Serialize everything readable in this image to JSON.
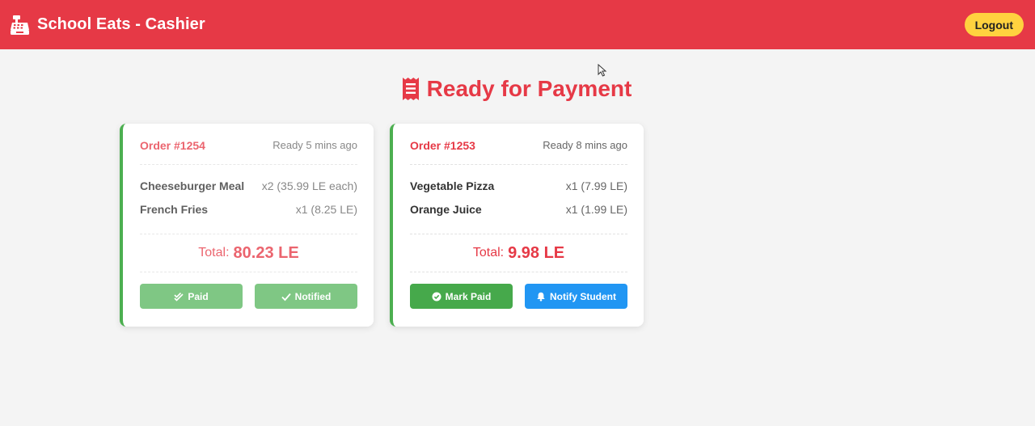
{
  "header": {
    "title": "School Eats - Cashier",
    "logout_label": "Logout",
    "icon": "cash-register-icon"
  },
  "page": {
    "heading": "Ready for Payment",
    "heading_icon": "receipt-icon"
  },
  "orders": [
    {
      "number": "Order #1254",
      "ready": "Ready 5 mins ago",
      "items": [
        {
          "name": "Cheeseburger Meal",
          "qty": "x2 (35.99 LE each)"
        },
        {
          "name": "French Fries",
          "qty": "x1 (8.25 LE)"
        }
      ],
      "total_label": "Total:",
      "total_value": "80.23 LE",
      "status": "completed",
      "actions": {
        "pay_label": "Paid",
        "notify_label": "Notified"
      }
    },
    {
      "number": "Order #1253",
      "ready": "Ready 8 mins ago",
      "items": [
        {
          "name": "Vegetable Pizza",
          "qty": "x1 (7.99 LE)"
        },
        {
          "name": "Orange Juice",
          "qty": "x1 (1.99 LE)"
        }
      ],
      "total_label": "Total:",
      "total_value": "9.98 LE",
      "status": "pending",
      "actions": {
        "pay_label": "Mark Paid",
        "notify_label": "Notify Student"
      }
    }
  ],
  "colors": {
    "brand": "#e63946",
    "logout": "#ffd23f",
    "card_accent": "#4caf50",
    "mark_paid": "#46a94b",
    "notify": "#2196f3",
    "completed_button": "#7fc784"
  }
}
